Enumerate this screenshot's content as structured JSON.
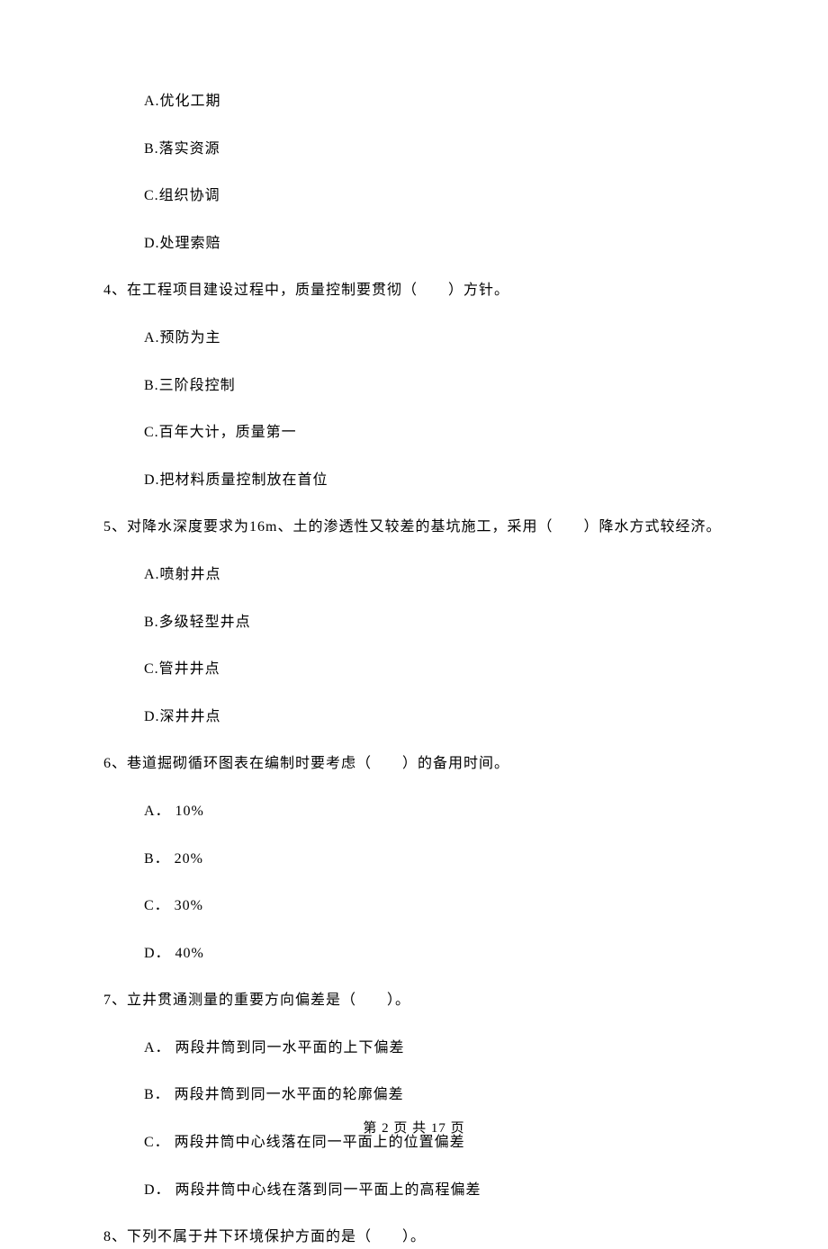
{
  "options_before_q4": [
    "A.优化工期",
    "B.落实资源",
    "C.组织协调",
    "D.处理索赔"
  ],
  "q4": {
    "stem": "4、在工程项目建设过程中，质量控制要贯彻（　　）方针。",
    "options": [
      "A.预防为主",
      "B.三阶段控制",
      "C.百年大计，质量第一",
      "D.把材料质量控制放在首位"
    ]
  },
  "q5": {
    "stem": "5、对降水深度要求为16m、土的渗透性又较差的基坑施工，采用（　　）降水方式较经济。",
    "options": [
      "A.喷射井点",
      "B.多级轻型井点",
      "C.管井井点",
      "D.深井井点"
    ]
  },
  "q6": {
    "stem": "6、巷道掘砌循环图表在编制时要考虑（　　）的备用时间。",
    "options": [
      "A． 10%",
      "B． 20%",
      "C． 30%",
      "D． 40%"
    ]
  },
  "q7": {
    "stem": "7、立井贯通测量的重要方向偏差是（　　）。",
    "options": [
      "A． 两段井筒到同一水平面的上下偏差",
      "B． 两段井筒到同一水平面的轮廓偏差",
      "C． 两段井筒中心线落在同一平面上的位置偏差",
      "D． 两段井筒中心线在落到同一平面上的高程偏差"
    ]
  },
  "q8": {
    "stem": "8、下列不属于井下环境保护方面的是（　　）。"
  },
  "footer": "第 2 页 共 17 页"
}
